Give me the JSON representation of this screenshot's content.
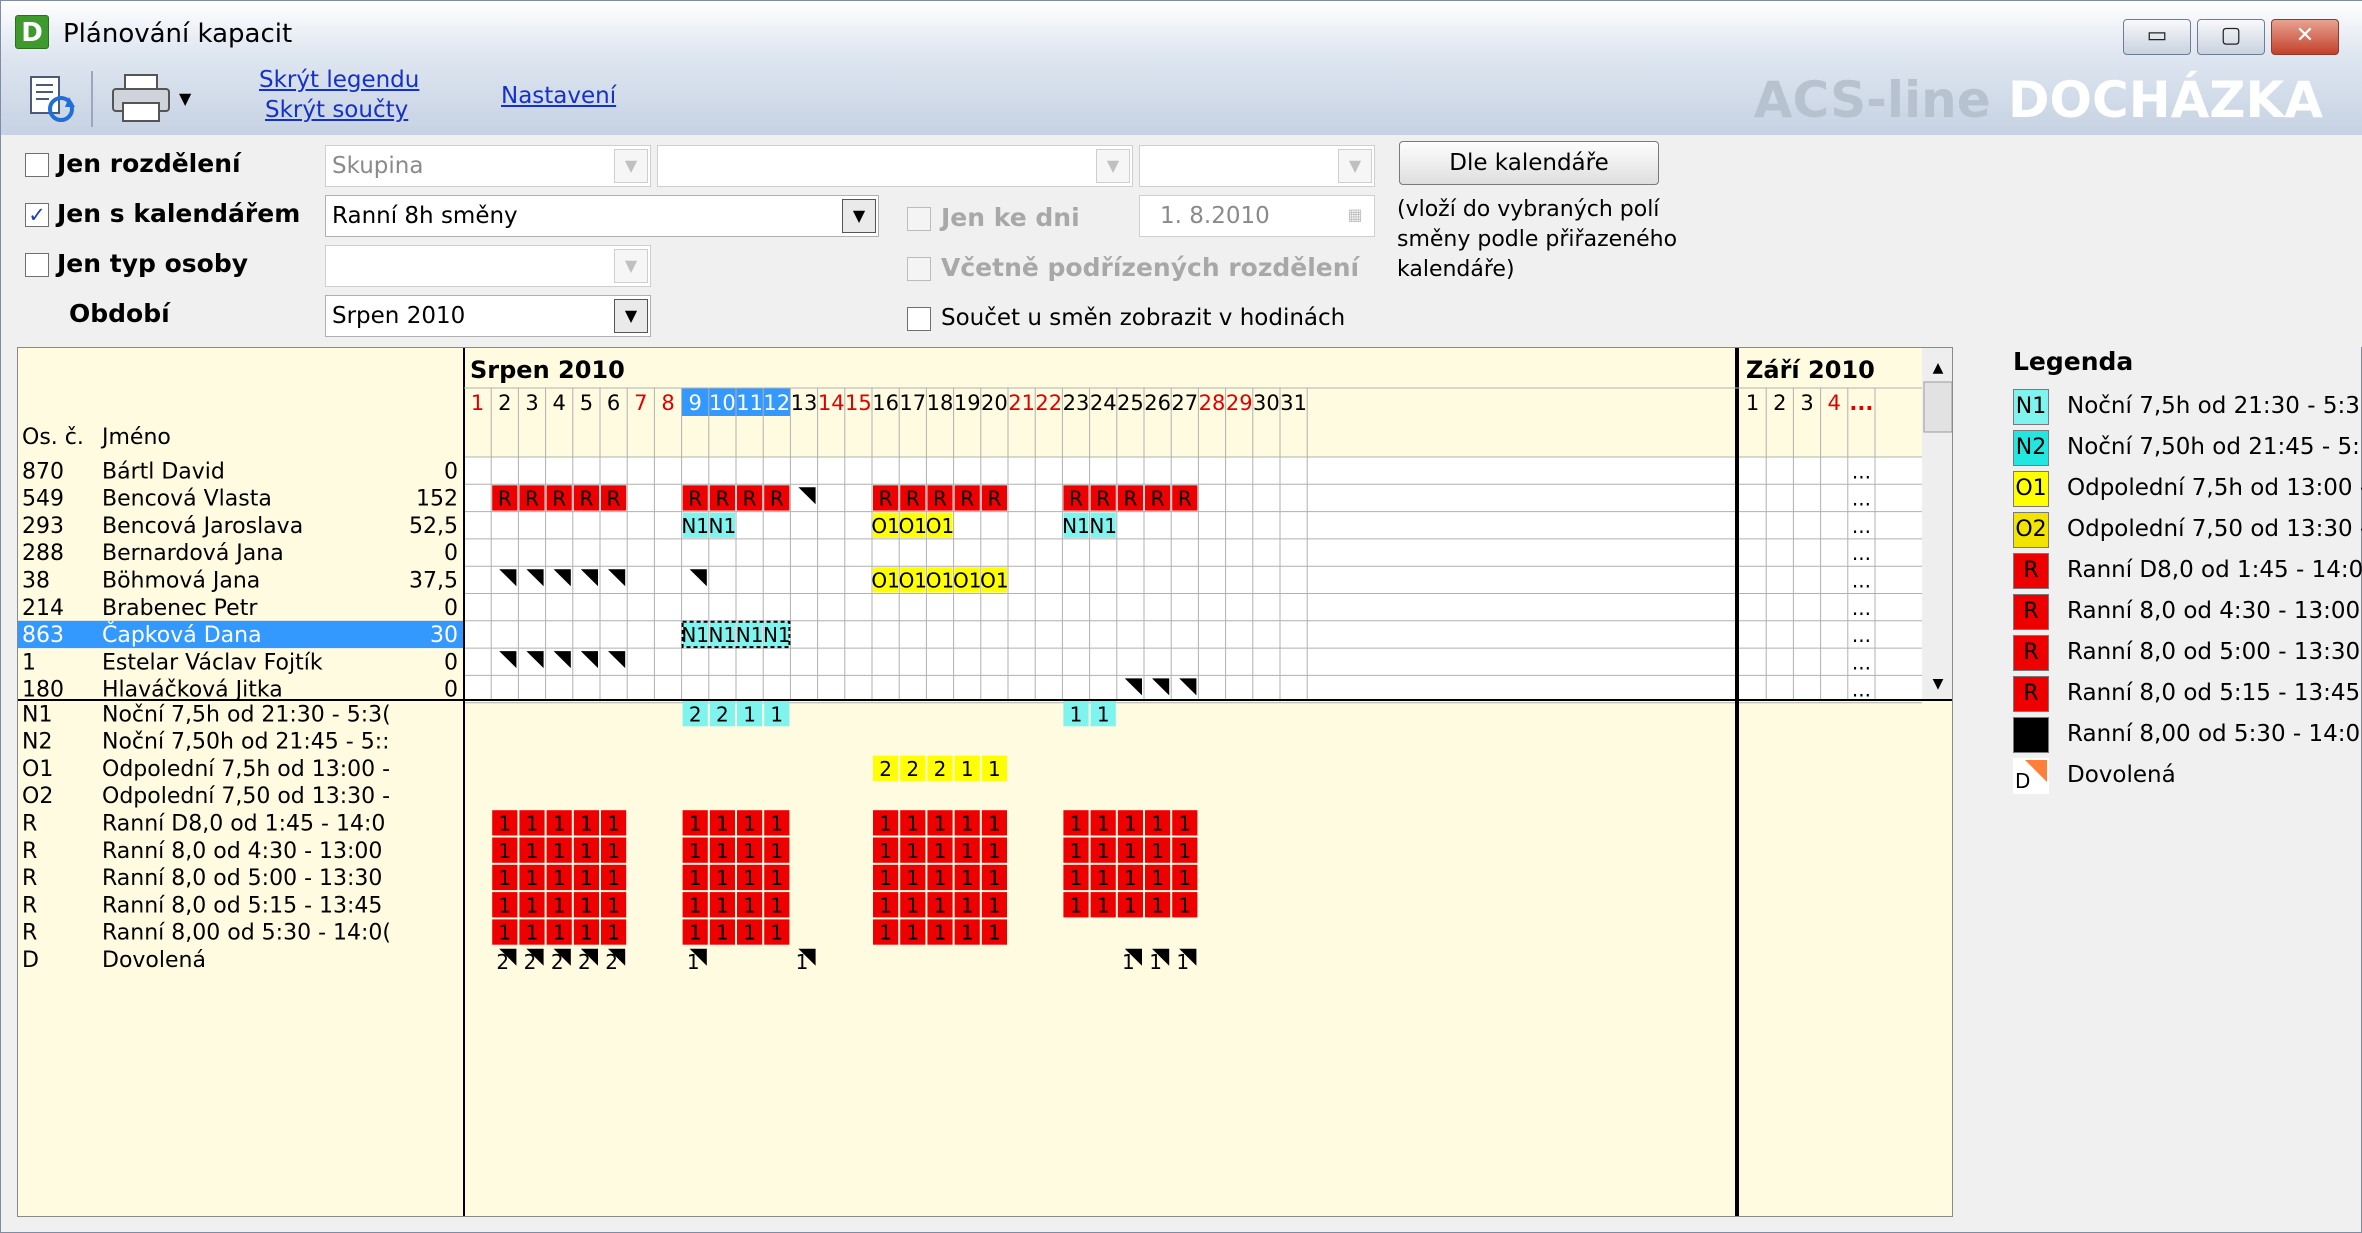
{
  "window": {
    "title": "Plánování kapacit",
    "icon_letter": "D",
    "minimize": "▭",
    "maximize": "▢",
    "close": "✕"
  },
  "toolbar": {
    "hide_legend": "Skrýt legendu",
    "hide_totals": "Skrýt součty",
    "settings": "Nastavení",
    "brand_light": "ACS-line",
    "brand_bold": "DOCHÁZKA"
  },
  "filters": {
    "only_division": "Jen rozdělení",
    "only_calendar": "Jen s kalendářem",
    "only_person_type": "Jen typ osoby",
    "period_label": "Období",
    "group_placeholder": "Skupina",
    "calendar_value": "Ranní 8h směny",
    "period_value": "Srpen 2010",
    "only_to_day": "Jen ke dni",
    "date_value": "1.  8.2010",
    "include_sub": "Včetně podřízených rozdělení",
    "sum_hours": "Součet u směn zobrazit v hodinách",
    "by_calendar_button": "Dle kalendáře",
    "by_calendar_note": [
      "(vloží do vybraných polí",
      "směny podle přiřazeného",
      "kalendáře)"
    ]
  },
  "grid": {
    "col_num": "Os. č.",
    "col_name": "Jméno",
    "month1": "Srpen  2010",
    "month2": "Září  2010",
    "more": "...",
    "days_aug": [
      1,
      2,
      3,
      4,
      5,
      6,
      7,
      8,
      9,
      10,
      11,
      12,
      13,
      14,
      15,
      16,
      17,
      18,
      19,
      20,
      21,
      22,
      23,
      24,
      25,
      26,
      27,
      28,
      29,
      30,
      31
    ],
    "weekend_aug": [
      1,
      7,
      8,
      14,
      15,
      21,
      22,
      28,
      29
    ],
    "selected_days": [
      9,
      10,
      11,
      12
    ],
    "days_sep": [
      1,
      2,
      3,
      4
    ],
    "weekend_sep": [
      4
    ],
    "persons": [
      {
        "num": "870",
        "name": "Bártl David",
        "total": "0",
        "cells": {}
      },
      {
        "num": "549",
        "name": "Bencová Vlasta",
        "total": "152",
        "cells": {
          "2": "R",
          "3": "R",
          "4": "R",
          "5": "R",
          "6": "R",
          "9": "R",
          "10": "R",
          "11": "R",
          "12": "R",
          "13": "D",
          "16": "R",
          "17": "R",
          "18": "R",
          "19": "R",
          "20": "R",
          "23": "R",
          "24": "R",
          "25": "R",
          "26": "R",
          "27": "R"
        }
      },
      {
        "num": "293",
        "name": "Bencová Jaroslava",
        "total": "52,5",
        "cells": {
          "9": "N1",
          "10": "N1",
          "16": "O1",
          "17": "O1",
          "18": "O1",
          "23": "N1",
          "24": "N1"
        }
      },
      {
        "num": "288",
        "name": "Bernardová Jana",
        "total": "0",
        "cells": {}
      },
      {
        "num": "38",
        "name": "Böhmová Jana",
        "total": "37,5",
        "cells": {
          "2": "D",
          "3": "D",
          "4": "D",
          "5": "D",
          "6": "D",
          "9": "D",
          "16": "O1",
          "17": "O1",
          "18": "O1",
          "19": "O1",
          "20": "O1"
        }
      },
      {
        "num": "214",
        "name": "Brabenec Petr",
        "total": "0",
        "cells": {}
      },
      {
        "num": "863",
        "name": "Čapková Dana",
        "total": "30",
        "selected": true,
        "cells": {
          "9": "N1",
          "10": "N1",
          "11": "N1",
          "12": "N1"
        }
      },
      {
        "num": "1",
        "name": "Estelar Václav Fojtík",
        "total": "0",
        "cells": {
          "2": "D",
          "3": "D",
          "4": "D",
          "5": "D",
          "6": "D"
        }
      },
      {
        "num": "180",
        "name": "Hlaváčková Jitka",
        "total": "0",
        "cells": {
          "25": "D",
          "26": "D",
          "27": "D"
        }
      }
    ],
    "summary": [
      {
        "code": "N1",
        "name": "Noční 7,5h od 21:30 - 5:3(",
        "type": "N1",
        "counts": {
          "9": "2",
          "10": "2",
          "11": "1",
          "12": "1",
          "23": "1",
          "24": "1"
        }
      },
      {
        "code": "N2",
        "name": "Noční 7,50h od 21:45 - 5::",
        "type": "N2",
        "counts": {}
      },
      {
        "code": "O1",
        "name": "Odpolední 7,5h od 13:00 -",
        "type": "O1",
        "counts": {
          "16": "2",
          "17": "2",
          "18": "2",
          "19": "1",
          "20": "1"
        }
      },
      {
        "code": "O2",
        "name": "Odpolední 7,50 od 13:30 -",
        "type": "O2",
        "counts": {}
      },
      {
        "code": "R",
        "name": "Ranní D8,0 od 1:45 - 14:0",
        "type": "R",
        "counts": {
          "2": "1",
          "3": "1",
          "4": "1",
          "5": "1",
          "6": "1",
          "9": "1",
          "10": "1",
          "11": "1",
          "12": "1",
          "16": "1",
          "17": "1",
          "18": "1",
          "19": "1",
          "20": "1",
          "23": "1",
          "24": "1",
          "25": "1",
          "26": "1",
          "27": "1"
        }
      },
      {
        "code": "R",
        "name": "Ranní 8,0 od 4:30 - 13:00",
        "type": "R",
        "counts": {
          "2": "1",
          "3": "1",
          "4": "1",
          "5": "1",
          "6": "1",
          "9": "1",
          "10": "1",
          "11": "1",
          "12": "1",
          "16": "1",
          "17": "1",
          "18": "1",
          "19": "1",
          "20": "1",
          "23": "1",
          "24": "1",
          "25": "1",
          "26": "1",
          "27": "1"
        }
      },
      {
        "code": "R",
        "name": "Ranní 8,0 od 5:00 - 13:30",
        "type": "R",
        "counts": {
          "2": "1",
          "3": "1",
          "4": "1",
          "5": "1",
          "6": "1",
          "9": "1",
          "10": "1",
          "11": "1",
          "12": "1",
          "16": "1",
          "17": "1",
          "18": "1",
          "19": "1",
          "20": "1",
          "23": "1",
          "24": "1",
          "25": "1",
          "26": "1",
          "27": "1"
        }
      },
      {
        "code": "R",
        "name": "Ranní 8,0 od 5:15 - 13:45",
        "type": "R",
        "counts": {
          "2": "1",
          "3": "1",
          "4": "1",
          "5": "1",
          "6": "1",
          "9": "1",
          "10": "1",
          "11": "1",
          "12": "1",
          "16": "1",
          "17": "1",
          "18": "1",
          "19": "1",
          "20": "1",
          "23": "1",
          "24": "1",
          "25": "1",
          "26": "1",
          "27": "1"
        }
      },
      {
        "code": "R",
        "name": "Ranní 8,00 od 5:30 - 14:0(",
        "type": "R",
        "counts": {
          "2": "1",
          "3": "1",
          "4": "1",
          "5": "1",
          "6": "1",
          "9": "1",
          "10": "1",
          "11": "1",
          "12": "1",
          "16": "1",
          "17": "1",
          "18": "1",
          "19": "1",
          "20": "1"
        }
      },
      {
        "code": "D",
        "name": "Dovolená",
        "type": "D",
        "counts": {
          "2": "2",
          "3": "2",
          "4": "2",
          "5": "2",
          "6": "2",
          "9": "1",
          "13": "1",
          "25": "1",
          "26": "1",
          "27": "1"
        }
      }
    ]
  },
  "legend": {
    "title": "Legenda",
    "items": [
      {
        "code": "N1",
        "text": "Noční 7,5h od 21:30 - 5:3",
        "color": "#7ff3ee"
      },
      {
        "code": "N2",
        "text": "Noční 7,50h od 21:45 - 5:",
        "color": "#22e6df"
      },
      {
        "code": "O1",
        "text": "Odpolední 7,5h od 13:00 -",
        "color": "#ffff00"
      },
      {
        "code": "O2",
        "text": "Odpolední 7,50 od 13:30 -",
        "color": "#f2e300"
      },
      {
        "code": "R",
        "text": "Ranní D8,0 od 1:45 - 14:0",
        "color": "#ee0000"
      },
      {
        "code": "R",
        "text": "Ranní 8,0 od 4:30 - 13:00",
        "color": "#ee0000"
      },
      {
        "code": "R",
        "text": "Ranní 8,0 od 5:00 - 13:30",
        "color": "#ee0000"
      },
      {
        "code": "R",
        "text": "Ranní 8,0 od 5:15 - 13:45",
        "color": "#ee0000"
      },
      {
        "code": "",
        "text": "Ranní 8,00 od 5:30 - 14:0",
        "color": "#000000"
      },
      {
        "code": "D",
        "text": "Dovolená",
        "color": "#ff7f3a"
      }
    ]
  },
  "colors": {
    "N1": "#7ff3ee",
    "N2": "#22e6df",
    "O1": "#ffff00",
    "O2": "#f2e300",
    "R": "#ee0000",
    "D": "#ff7f3a",
    "header_bg": "#fffbe0",
    "weekend": "#e00000",
    "selection": "#3399ff"
  }
}
